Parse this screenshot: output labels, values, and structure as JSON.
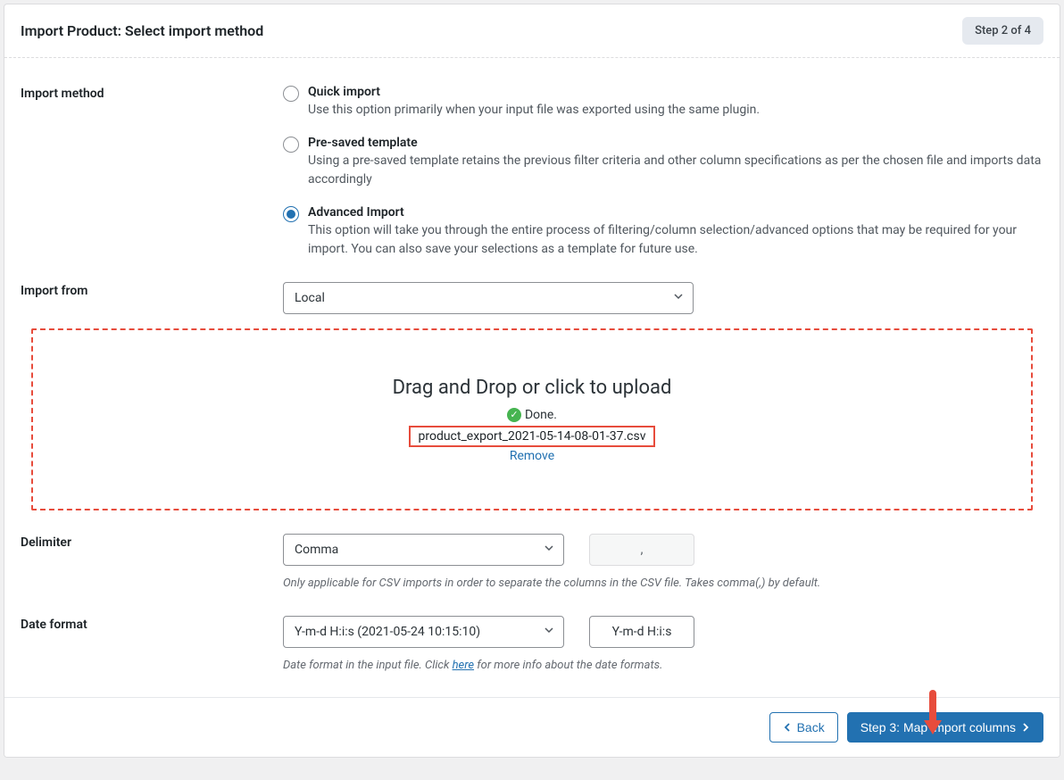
{
  "header": {
    "title": "Import Product: Select import method",
    "step_badge": "Step 2 of 4"
  },
  "import_method": {
    "label": "Import method",
    "options": [
      {
        "title": "Quick import",
        "desc": "Use this option primarily when your input file was exported using the same plugin.",
        "selected": false
      },
      {
        "title": "Pre-saved template",
        "desc": "Using a pre-saved template retains the previous filter criteria and other column specifications as per the chosen file and imports data accordingly",
        "selected": false
      },
      {
        "title": "Advanced Import",
        "desc": "This option will take you through the entire process of filtering/column selection/advanced options that may be required for your import. You can also save your selections as a template for future use.",
        "selected": true
      }
    ]
  },
  "import_from": {
    "label": "Import from",
    "value": "Local"
  },
  "dropzone": {
    "title": "Drag and Drop or click to upload",
    "done_label": "Done.",
    "filename": "product_export_2021-05-14-08-01-37.csv",
    "remove_label": "Remove"
  },
  "delimiter": {
    "label": "Delimiter",
    "value": "Comma",
    "input_value": ",",
    "help": "Only applicable for CSV imports in order to separate the columns in the CSV file. Takes comma(,) by default."
  },
  "date_format": {
    "label": "Date format",
    "value": "Y-m-d H:i:s (2021-05-24 10:15:10)",
    "input_value": "Y-m-d H:i:s",
    "help_prefix": "Date format in the input file. Click ",
    "help_link": "here",
    "help_suffix": " for more info about the date formats."
  },
  "footer": {
    "back_label": "Back",
    "next_label": "Step 3: Map import columns"
  }
}
